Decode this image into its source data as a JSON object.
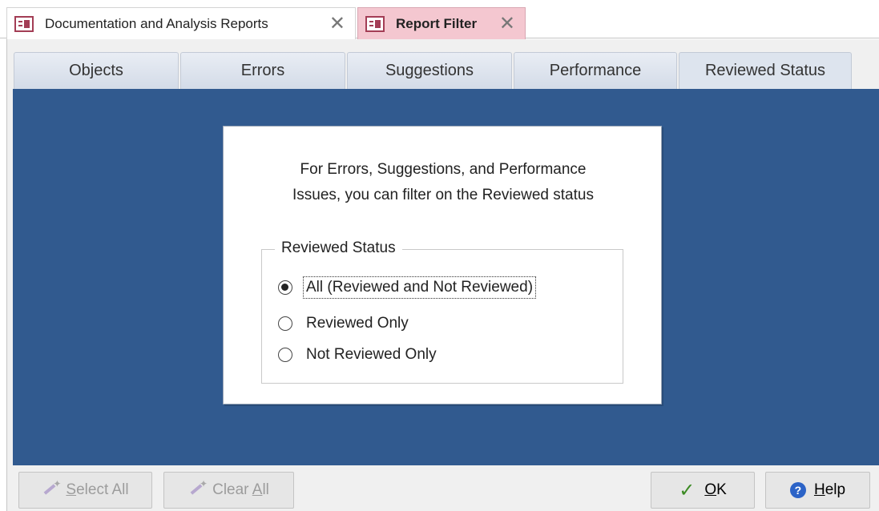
{
  "doc_tabs": [
    {
      "label": "Documentation and Analysis Reports",
      "close": "✕"
    },
    {
      "label": "Report Filter",
      "close": "✕"
    }
  ],
  "page_tabs": [
    "Objects",
    "Errors",
    "Suggestions",
    "Performance",
    "Reviewed Status"
  ],
  "panel": {
    "text": "For Errors, Suggestions, and Performance\nIssues, you can filter on the Reviewed status",
    "group_label": "Reviewed Status",
    "options": [
      {
        "label": "All (Reviewed and Not Reviewed)",
        "checked": true
      },
      {
        "label": "Reviewed Only",
        "checked": false
      },
      {
        "label": "Not Reviewed Only",
        "checked": false
      }
    ]
  },
  "buttons": {
    "select_all": {
      "first": "S",
      "rest": "elect All"
    },
    "clear_all": {
      "pre": "Clear ",
      "accel": "A",
      "rest": "ll"
    },
    "ok": {
      "accel": "O",
      "rest": "K"
    },
    "help": {
      "accel": "H",
      "rest": "elp"
    }
  },
  "colors": {
    "tab_body": "#315a8f",
    "active_doc_tab": "#f4c7d0",
    "ok_check": "#3b8a23"
  }
}
